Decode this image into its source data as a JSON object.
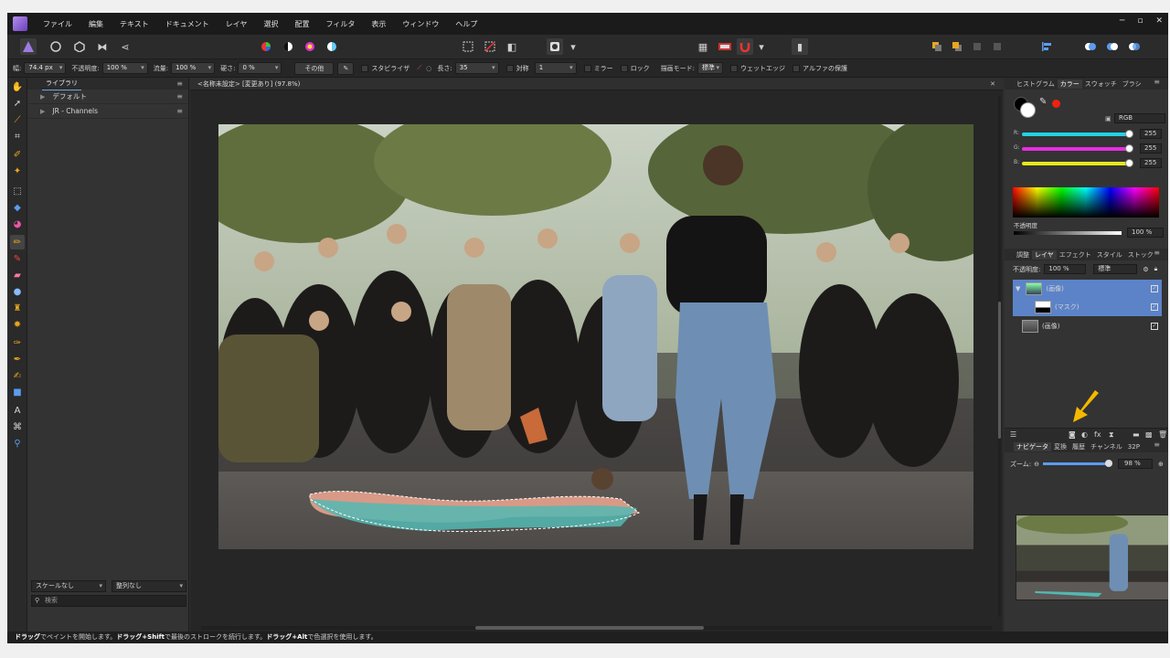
{
  "menu": [
    "ファイル",
    "編集",
    "テキスト",
    "ドキュメント",
    "レイヤ",
    "選択",
    "配置",
    "フィルタ",
    "表示",
    "ウィンドウ",
    "ヘルプ"
  ],
  "window_controls": [
    "─",
    "▫",
    "✕"
  ],
  "context_bar": {
    "width_label": "幅:",
    "width_value": "74.4 px",
    "opacity_label": "不透明度:",
    "opacity_value": "100 %",
    "flow_label": "流量:",
    "flow_value": "100 %",
    "hardness_label": "硬さ:",
    "hardness_value": "0 %",
    "more_button": "その他",
    "stabilize_label": "スタビライザ",
    "length_label": "長さ:",
    "length_value": "35",
    "symmetry_label": "対称",
    "symmetry_value": "1",
    "mirror_label": "ミラー",
    "lock_label": "ロック",
    "mode_label": "描画モード:",
    "mode_value": "標準",
    "wet_label": "ウェットエッジ",
    "alpha_label": "アルファの保護"
  },
  "left_panel": {
    "tab": "ライブラリ",
    "items": [
      "デフォルト",
      "JR - Channels"
    ],
    "scale_select": "スケールなし",
    "sort_select": "整列なし",
    "search_placeholder": "検索"
  },
  "document": {
    "tab_title": "<名称未設定> [変更あり] (97.8%)",
    "close": "✕"
  },
  "color_panel": {
    "tabs": [
      "ヒストグラム",
      "カラー",
      "スウォッチ",
      "ブラシ"
    ],
    "active_tab": "カラー",
    "model": "RGB",
    "channels": [
      {
        "label": "R:",
        "value": "255",
        "color": "#22d3e6"
      },
      {
        "label": "G:",
        "value": "255",
        "color": "#e62ee0"
      },
      {
        "label": "B:",
        "value": "255",
        "color": "#e8e81e"
      }
    ],
    "opacity_label": "不透明度",
    "opacity_value": "100 %"
  },
  "layers_panel": {
    "tabs": [
      "調整",
      "レイヤ",
      "エフェクト",
      "スタイル",
      "ストック"
    ],
    "active_tab": "レイヤ",
    "opacity_value": "100 %",
    "opacity_label": "不透明度:",
    "blend_mode": "標準",
    "layers": [
      {
        "name": "(画像)",
        "selected": true
      },
      {
        "name": "(マスク)",
        "selected": true
      },
      {
        "name": "(画像)",
        "selected": false
      }
    ]
  },
  "navigator_panel": {
    "tabs": [
      "ナビゲータ",
      "変換",
      "履歴",
      "チャンネル",
      "32P"
    ],
    "active_tab": "ナビゲータ",
    "zoom_label": "ズーム:",
    "zoom_value": "98 %"
  },
  "status_bar": {
    "drag": "ドラッグ",
    "t1": "でペイントを開始します。",
    "shift": "ドラッグ+Shift",
    "t2": "で最後のストロークを続行します。",
    "alt": "ドラッグ+Alt",
    "t3": "で色選択を使用します。"
  },
  "accent_colors": {
    "highlight_arrow": "#f5b800",
    "selection": "#4a7ec9"
  }
}
